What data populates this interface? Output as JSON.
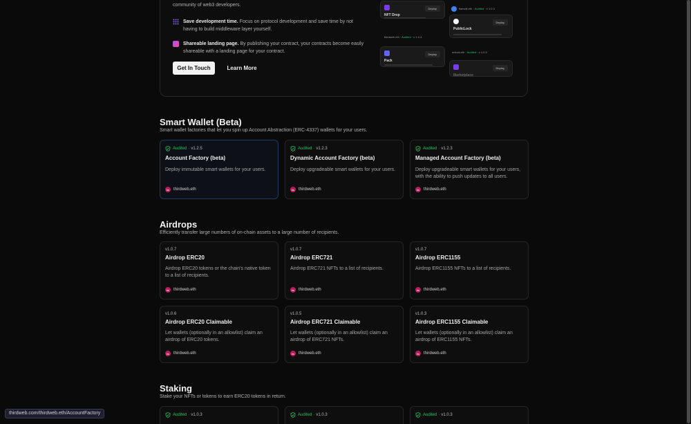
{
  "hero": {
    "intro_tail": "community of web3 developers.",
    "features": [
      {
        "title": "Save development time.",
        "text": "Focus on protocol development and save time by not having to build middleware layer yourself.",
        "color": "#7c3aed"
      },
      {
        "title": "Shareable landing page.",
        "text": "By publishing your contract, your contracts become easily shareable with a landing page for your contract.",
        "color": "#c084fc"
      }
    ],
    "cta_primary": "Get In Touch",
    "cta_secondary": "Learn More",
    "preview": {
      "nft_drop": "NFT Drop",
      "publiclock": "PublicLock",
      "pack": "Pack",
      "marketplace": "Marketplace",
      "deploy": "Deploy",
      "author1": "thirdweb.eth",
      "author2": "unlock.eth",
      "author3": "flairsdk.eth",
      "audited": "Audited",
      "v1": "v 1.0.3",
      "v2": "v 1.0.3"
    }
  },
  "sections": [
    {
      "title": "Smart Wallet (Beta)",
      "subtitle": "Smart wallet factories that let you spin up Account Abstraction (ERC-4337) wallets for your users.",
      "cards": [
        {
          "audited": "Audited",
          "version": "v1.2.5",
          "title": "Account Factory (beta)",
          "desc": "Deploy immutable smart wallets for your users.",
          "publisher": "thirdweb.eth"
        },
        {
          "audited": "Audited",
          "version": "v1.2.3",
          "title": "Dynamic Account Factory (beta)",
          "desc": "Deploy upgradeable smart wallets for your users.",
          "publisher": "thirdweb.eth"
        },
        {
          "audited": "Audited",
          "version": "v1.2.3",
          "title": "Managed Account Factory (beta)",
          "desc": "Deploy upgradeable smart wallets for your users, with the ability to push updates to all users.",
          "publisher": "thirdweb.eth"
        }
      ]
    },
    {
      "title": "Airdrops",
      "subtitle": "Efficiently transfer large numbers of on-chain assets to a large number of recipients.",
      "cards": [
        {
          "version": "v1.0.7",
          "title": "Airdrop ERC20",
          "desc": "Airdrop ERC20 tokens or the chain's native token to a list of recipients.",
          "publisher": "thirdweb.eth"
        },
        {
          "version": "v1.0.7",
          "title": "Airdrop ERC721",
          "desc": "Airdrop ERC721 NFTs to a list of recipients.",
          "publisher": "thirdweb.eth"
        },
        {
          "version": "v1.0.7",
          "title": "Airdrop ERC1155",
          "desc": "Airdrop ERC1155 NFTs to a list of recipients.",
          "publisher": "thirdweb.eth"
        },
        {
          "version": "v1.0.6",
          "title": "Airdrop ERC20 Claimable",
          "desc": "Let wallets (optionally in an allowlist) claim an airdrop of ERC20 tokens.",
          "publisher": "thirdweb.eth"
        },
        {
          "version": "v1.0.5",
          "title": "Airdrop ERC721 Claimable",
          "desc": "Let wallets (optionally in an allowlist) claim an airdrop of ERC721 NFTs.",
          "publisher": "thirdweb.eth"
        },
        {
          "version": "v1.0.3",
          "title": "Airdrop ERC1155 Claimable",
          "desc": "Let wallets (optionally in an allowlist) claim an airdrop of ERC1155 NFTs.",
          "publisher": "thirdweb.eth"
        }
      ]
    },
    {
      "title": "Staking",
      "subtitle": "Stake your NFTs or tokens to earn ERC20 tokens in return.",
      "cards": [
        {
          "audited": "Audited",
          "version": "v1.0.3"
        },
        {
          "audited": "Audited",
          "version": "v1.0.3"
        },
        {
          "audited": "Audited",
          "version": "v1.0.3"
        }
      ]
    }
  ],
  "status_url": "thirdweb.com/thirdweb.eth/AccountFactory",
  "colors": {
    "audited": "#22c55e",
    "avatar": "#b91c5c",
    "selected_border": "#1e3a5f"
  }
}
